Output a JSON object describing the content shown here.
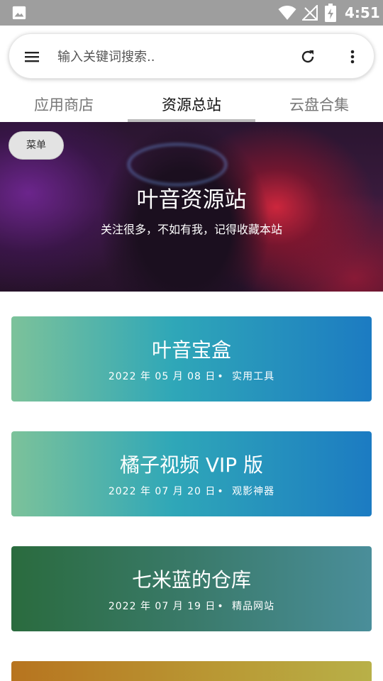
{
  "status_bar": {
    "time": "4:51",
    "icons": [
      "image-icon",
      "wifi-icon",
      "signal-off-icon",
      "battery-charging-icon"
    ]
  },
  "search": {
    "placeholder": "输入关键词搜索..",
    "value": ""
  },
  "tabs": [
    {
      "label": "应用商店",
      "active": false
    },
    {
      "label": "资源总站",
      "active": true
    },
    {
      "label": "云盘合集",
      "active": false
    }
  ],
  "banner": {
    "menu_label": "菜单",
    "title": "叶音资源站",
    "subtitle": "关注很多，不如有我，记得收藏本站"
  },
  "cards": [
    {
      "title": "叶音宝盒",
      "year": "2022",
      "month": "05",
      "day": "08",
      "category": "实用工具"
    },
    {
      "title": "橘子视频 VIP 版",
      "year": "2022",
      "month": "07",
      "day": "20",
      "category": "观影神器"
    },
    {
      "title": "七米蓝的仓库",
      "year": "2022",
      "month": "07",
      "day": "19",
      "category": "精品网站"
    }
  ],
  "date_units": {
    "year": "年",
    "month": "月",
    "day": "日",
    "dot": "•"
  },
  "colors": {
    "status_bar": "#9e9e9e",
    "tab_indicator": "#bdbdbd",
    "card_gradient_start": "#7cc29a",
    "card_gradient_end": "#1c7bc2",
    "card3_start": "#2a6b3e",
    "card4_start": "#b7741f"
  }
}
